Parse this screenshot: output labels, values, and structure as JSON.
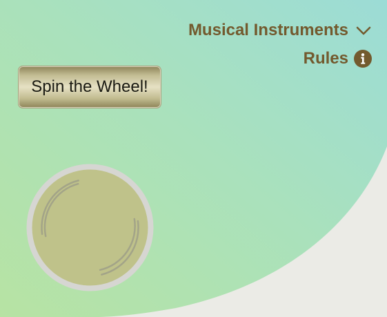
{
  "header": {
    "category_label": "Musical Instruments",
    "category_icon": "chevron-down-icon",
    "rules_label": "Rules",
    "rules_icon": "info-icon"
  },
  "game": {
    "spin_button_label": "Spin the Wheel!",
    "wheel_icon": "spinning-wheel"
  },
  "colors": {
    "accent_text": "#735a2e",
    "gradient_top_right": "#9edcd8",
    "gradient_bottom_left": "#b5e3a4",
    "page_background": "#ebebe6",
    "wheel_fill": "#bfc28a",
    "wheel_rim": "#d6d6d2"
  }
}
